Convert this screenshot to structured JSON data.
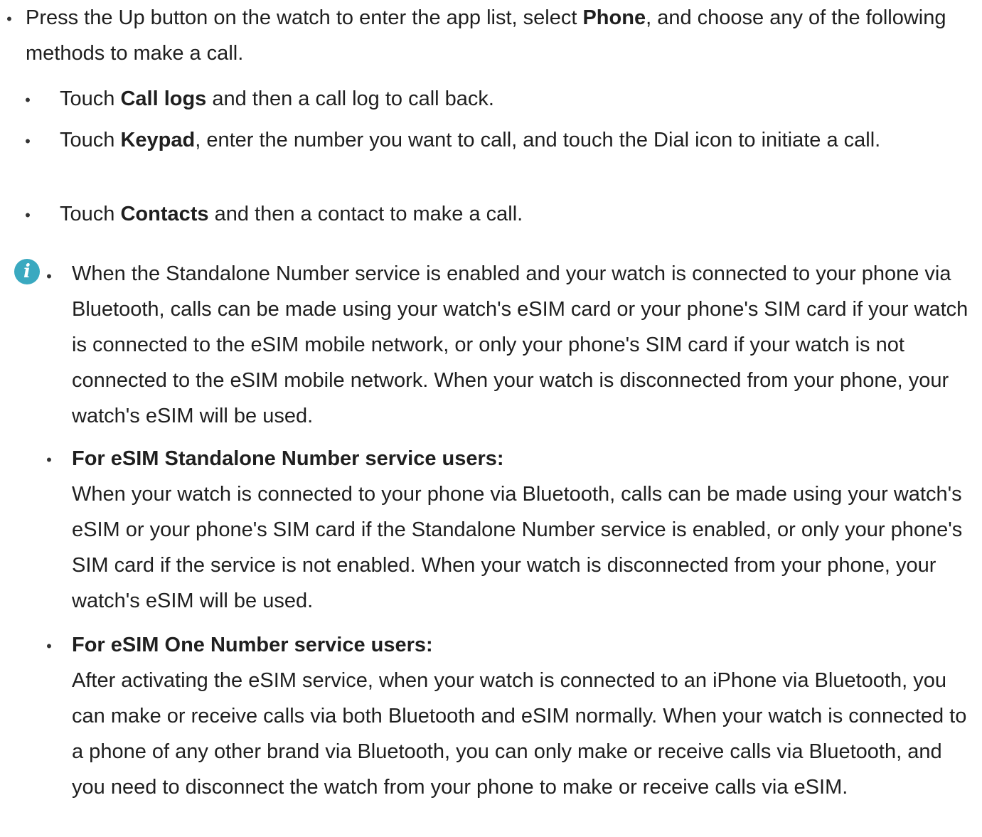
{
  "main_item": {
    "before": "Press the Up button on the watch to enter the app list, select ",
    "bold": "Phone",
    "after": ", and choose any of the following methods to make a call."
  },
  "sub_items": [
    {
      "before": "Touch ",
      "bold": "Call logs",
      "after": " and then a call log to call back."
    },
    {
      "before": "Touch ",
      "bold": "Keypad",
      "after": ", enter the number you want to call, and touch the Dial icon to initiate a call."
    },
    {
      "before": "Touch ",
      "bold": "Contacts",
      "after": " and then a contact to make a call."
    }
  ],
  "note": {
    "icon": "info-icon",
    "icon_color": "#3aa9c0",
    "paragraph": "When the Standalone Number service is enabled and your watch is connected to your phone via Bluetooth, calls can be made using your watch's eSIM card or your phone's SIM card if your watch is connected to the eSIM mobile network, or only your phone's SIM card if your watch is not connected to the eSIM mobile network. When your watch is disconnected from your phone, your watch's eSIM will be used.",
    "items": [
      {
        "heading": "For eSIM Standalone Number service users:",
        "body": "When your watch is connected to your phone via Bluetooth, calls can be made using your watch's eSIM or your phone's SIM card if the Standalone Number service is enabled, or only your phone's SIM card if the service is not enabled. When your watch is disconnected from your phone, your watch's eSIM will be used."
      },
      {
        "heading": "For eSIM One Number service users:",
        "body": "After activating the eSIM service, when your watch is connected to an iPhone via Bluetooth, you can make or receive calls via both Bluetooth and eSIM normally. When your watch is connected to a phone of any other brand via Bluetooth, you can only make or receive calls via Bluetooth, and you need to disconnect the watch from your phone to make or receive calls via eSIM."
      }
    ]
  }
}
